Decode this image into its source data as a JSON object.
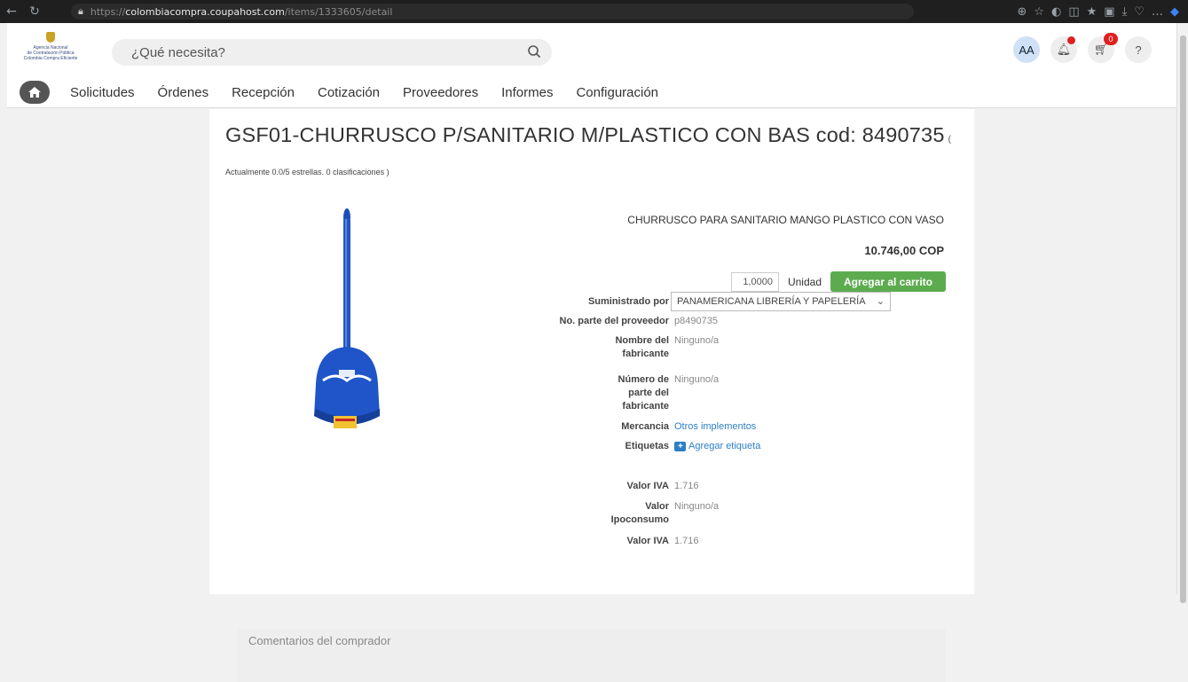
{
  "browser": {
    "url_proto": "https://",
    "url_host": "colombiacompra.coupahost.com",
    "url_path": "/items/1333605/detail"
  },
  "header": {
    "logo_line1": "Agencia Nacional",
    "logo_line2": "de Contratación Pública",
    "logo_line3": "Colombia Compra Eficiente",
    "search_placeholder": "¿Qué necesita?",
    "avatar": "AA",
    "cart_count": "0",
    "help": "?"
  },
  "nav": {
    "items": [
      "Solicitudes",
      "Órdenes",
      "Recepción",
      "Cotización",
      "Proveedores",
      "Informes",
      "Configuración"
    ]
  },
  "item": {
    "title": "GSF01-CHURRUSCO P/SANITARIO M/PLASTICO CON BAS cod: 8490735",
    "title_suffix": "(",
    "rating_text": "Actualmente 0.0/5 estrellas. 0 clasificaciones )",
    "description": "CHURRUSCO PARA SANITARIO MANGO PLASTICO CON VASO",
    "price": "10.746,00 COP",
    "quantity": "1,0000",
    "unit": "Unidad",
    "add_to_cart": "Agregar al carrito"
  },
  "properties": {
    "supplier_label": "Suministrado por",
    "supplier_value": "PANAMERICANA LIBRERÍA Y PAPELERÍA",
    "part_label": "No. parte del proveedor",
    "part_value": "p8490735",
    "mfr_name_label": "Nombre del fabricante",
    "mfr_name_value": "Ninguno/a",
    "mfr_part_label": "Número de parte del fabricante",
    "mfr_part_value": "Ninguno/a",
    "commodity_label": "Mercancia",
    "commodity_value": "Otros implementos",
    "tags_label": "Etiquetas",
    "tags_value": "Agregar etiqueta",
    "iva_label": "Valor IVA",
    "iva_value": "1.716",
    "ipo_label": "Valor Ipoconsumo",
    "ipo_value": "Ninguno/a",
    "iva2_label": "Valor IVA",
    "iva2_value": "1.716"
  },
  "comments": {
    "title": "Comentarios del comprador"
  },
  "colors": {
    "accent_green": "#5cac4f",
    "link_blue": "#2d7fc6",
    "badge_red": "#e02020"
  }
}
